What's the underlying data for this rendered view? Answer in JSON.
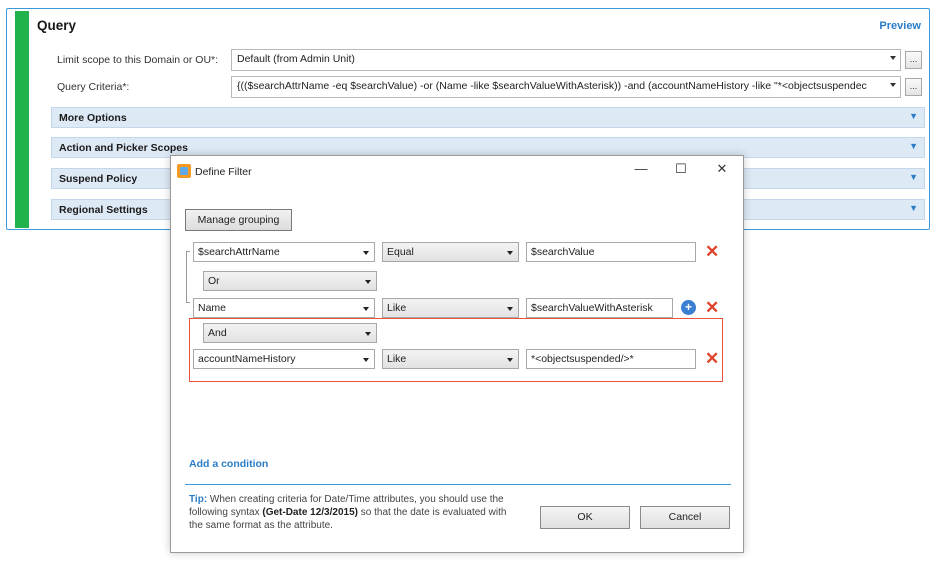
{
  "query_panel": {
    "title": "Query",
    "preview_label": "Preview",
    "scope_label": "Limit scope to this Domain or OU*:",
    "scope_value": "Default (from Admin Unit)",
    "criteria_label": "Query Criteria*:",
    "criteria_value": "{(($searchAttrName -eq $searchValue) -or (Name -like $searchValueWithAsterisk)) -and (accountNameHistory -like \"*<objectsuspendec",
    "ellipsis_label": "...",
    "sections": [
      {
        "label": "More Options"
      },
      {
        "label": "Action and Picker Scopes"
      },
      {
        "label": "Suspend Policy"
      },
      {
        "label": "Regional Settings"
      }
    ],
    "accent_color": "#22b24c"
  },
  "dialog": {
    "title": "Define Filter",
    "minimize_glyph": "—",
    "maximize_glyph": "☐",
    "close_glyph": "✕",
    "manage_grouping_label": "Manage grouping",
    "conditions": [
      {
        "attribute": "$searchAttrName",
        "operator": "Equal",
        "value": "$searchValue"
      },
      {
        "attribute": "Name",
        "operator": "Like",
        "value": "$searchValueWithAsterisk"
      },
      {
        "attribute": "accountNameHistory",
        "operator": "Like",
        "value": "*<objectsuspended/>*"
      }
    ],
    "group_operators": [
      "Or",
      "And"
    ],
    "add_condition_label": "Add a condition",
    "tip": {
      "label": "Tip:",
      "text_before": " When creating criteria for Date/Time attributes, you should use the following syntax ",
      "bold": "(Get-Date 12/3/2015)",
      "text_after": " so that the date is evaluated with the same format as the attribute."
    },
    "ok_label": "OK",
    "cancel_label": "Cancel",
    "delete_glyph": "✕",
    "add_glyph": "+",
    "highlight_color": "#e8553c"
  }
}
